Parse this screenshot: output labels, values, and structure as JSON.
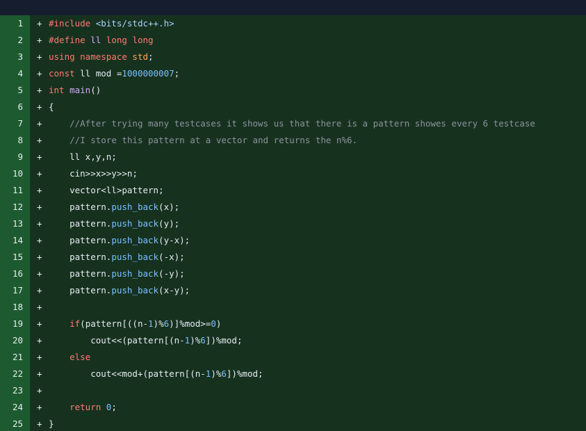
{
  "colors": {
    "topbar": "#151d2e",
    "gutter_bg": "#1e5a2f",
    "code_bg": "#17311f",
    "text": "#e6edf3",
    "keyword": "#ff7b72",
    "string": "#a5d6ff",
    "number": "#79c0ff",
    "function": "#d2a8ff",
    "comment": "#8b949e"
  },
  "diff_marker": "+",
  "lines": [
    {
      "num": "1",
      "tokens": [
        [
          "pp",
          "#include "
        ],
        [
          "str",
          "<bits/stdc++.h>"
        ]
      ]
    },
    {
      "num": "2",
      "tokens": [
        [
          "pp",
          "#define "
        ],
        [
          "fn",
          "ll"
        ],
        [
          "plain",
          " "
        ],
        [
          "kw",
          "long long"
        ]
      ]
    },
    {
      "num": "3",
      "tokens": [
        [
          "kw",
          "using namespace "
        ],
        [
          "std",
          "std"
        ],
        [
          "plain",
          ";"
        ]
      ]
    },
    {
      "num": "4",
      "tokens": [
        [
          "kw",
          "const "
        ],
        [
          "plain",
          "ll mod ="
        ],
        [
          "num",
          "1000000007"
        ],
        [
          "plain",
          ";"
        ]
      ]
    },
    {
      "num": "5",
      "tokens": [
        [
          "kw",
          "int "
        ],
        [
          "fn",
          "main"
        ],
        [
          "plain",
          "()"
        ]
      ]
    },
    {
      "num": "6",
      "tokens": [
        [
          "plain",
          "{"
        ]
      ]
    },
    {
      "num": "7",
      "tokens": [
        [
          "plain",
          "    "
        ],
        [
          "cm",
          "//After trying many testcases it shows us that there is a pattern showes every 6 testcase"
        ]
      ]
    },
    {
      "num": "8",
      "tokens": [
        [
          "plain",
          "    "
        ],
        [
          "cm",
          "//I store this pattern at a vector and returns the n%6."
        ]
      ]
    },
    {
      "num": "9",
      "tokens": [
        [
          "plain",
          "    ll x,y,n;"
        ]
      ]
    },
    {
      "num": "10",
      "tokens": [
        [
          "plain",
          "    cin>>x>>y>>n;"
        ]
      ]
    },
    {
      "num": "11",
      "tokens": [
        [
          "plain",
          "    vector<ll>pattern;"
        ]
      ]
    },
    {
      "num": "12",
      "tokens": [
        [
          "plain",
          "    pattern."
        ],
        [
          "method",
          "push_back"
        ],
        [
          "plain",
          "(x);"
        ]
      ]
    },
    {
      "num": "13",
      "tokens": [
        [
          "plain",
          "    pattern."
        ],
        [
          "method",
          "push_back"
        ],
        [
          "plain",
          "(y);"
        ]
      ]
    },
    {
      "num": "14",
      "tokens": [
        [
          "plain",
          "    pattern."
        ],
        [
          "method",
          "push_back"
        ],
        [
          "plain",
          "(y-x);"
        ]
      ]
    },
    {
      "num": "15",
      "tokens": [
        [
          "plain",
          "    pattern."
        ],
        [
          "method",
          "push_back"
        ],
        [
          "plain",
          "(-x);"
        ]
      ]
    },
    {
      "num": "16",
      "tokens": [
        [
          "plain",
          "    pattern."
        ],
        [
          "method",
          "push_back"
        ],
        [
          "plain",
          "(-y);"
        ]
      ]
    },
    {
      "num": "17",
      "tokens": [
        [
          "plain",
          "    pattern."
        ],
        [
          "method",
          "push_back"
        ],
        [
          "plain",
          "(x-y);"
        ]
      ]
    },
    {
      "num": "18",
      "tokens": [
        [
          "plain",
          ""
        ]
      ]
    },
    {
      "num": "19",
      "tokens": [
        [
          "plain",
          "    "
        ],
        [
          "kw",
          "if"
        ],
        [
          "plain",
          "(pattern[((n-"
        ],
        [
          "num",
          "1"
        ],
        [
          "plain",
          ")%"
        ],
        [
          "num",
          "6"
        ],
        [
          "plain",
          ")]%mod>="
        ],
        [
          "num",
          "0"
        ],
        [
          "plain",
          ")"
        ]
      ]
    },
    {
      "num": "20",
      "tokens": [
        [
          "plain",
          "        cout<<(pattern[(n-"
        ],
        [
          "num",
          "1"
        ],
        [
          "plain",
          ")%"
        ],
        [
          "num",
          "6"
        ],
        [
          "plain",
          "])%mod;"
        ]
      ]
    },
    {
      "num": "21",
      "tokens": [
        [
          "plain",
          "    "
        ],
        [
          "kw",
          "else"
        ]
      ]
    },
    {
      "num": "22",
      "tokens": [
        [
          "plain",
          "        cout<<mod+(pattern[(n-"
        ],
        [
          "num",
          "1"
        ],
        [
          "plain",
          ")%"
        ],
        [
          "num",
          "6"
        ],
        [
          "plain",
          "])%mod;"
        ]
      ]
    },
    {
      "num": "23",
      "tokens": [
        [
          "plain",
          ""
        ]
      ]
    },
    {
      "num": "24",
      "tokens": [
        [
          "plain",
          "    "
        ],
        [
          "kw",
          "return "
        ],
        [
          "num",
          "0"
        ],
        [
          "plain",
          ";"
        ]
      ]
    },
    {
      "num": "25",
      "tokens": [
        [
          "plain",
          "}"
        ]
      ]
    }
  ]
}
